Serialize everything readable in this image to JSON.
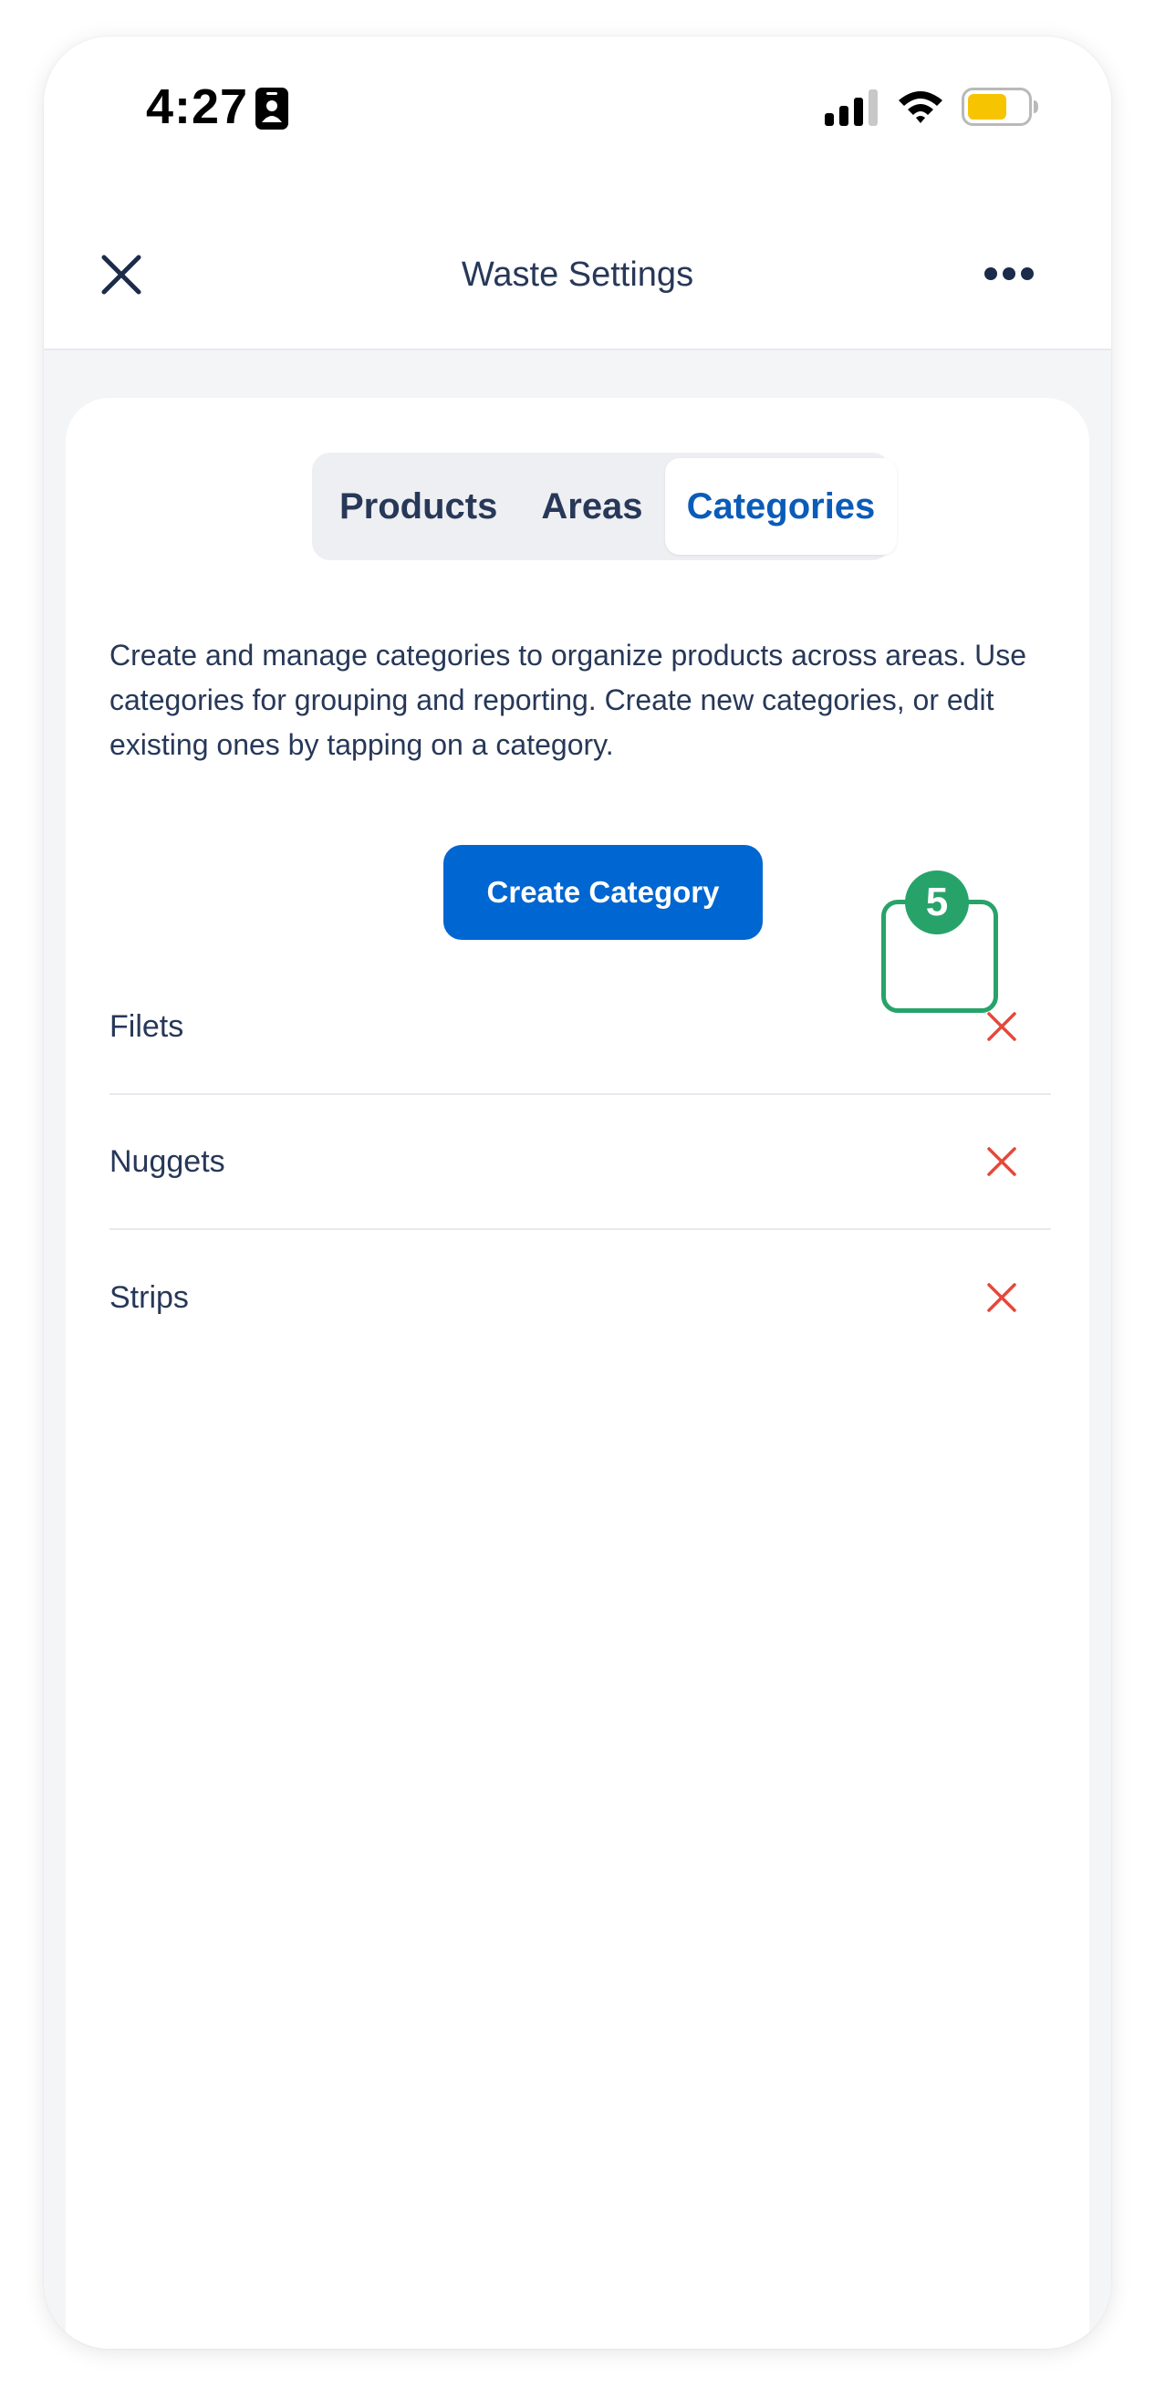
{
  "status_bar": {
    "time": "4:27",
    "battery_color": "#f6c400"
  },
  "nav": {
    "title": "Waste Settings"
  },
  "tabs": [
    {
      "label": "Products",
      "active": false
    },
    {
      "label": "Areas",
      "active": false
    },
    {
      "label": "Categories",
      "active": true
    }
  ],
  "description": "Create and manage categories to organize products across areas. Use categories for grouping and reporting. Create new categories, or edit existing ones by tapping on a category.",
  "create_button": {
    "label": "Create Category"
  },
  "categories": [
    {
      "label": "Filets"
    },
    {
      "label": "Nuggets"
    },
    {
      "label": "Strips"
    }
  ],
  "annotation": {
    "number": "5"
  },
  "colors": {
    "accent": "#0066d1",
    "active_tab_text": "#0a5cb8",
    "delete": "#e5483b",
    "annotation": "#27a36a",
    "text": "#273858"
  },
  "icons": [
    "id-card-icon",
    "signal-icon",
    "wifi-icon",
    "battery-icon",
    "close-icon",
    "more-icon",
    "delete-icon"
  ]
}
